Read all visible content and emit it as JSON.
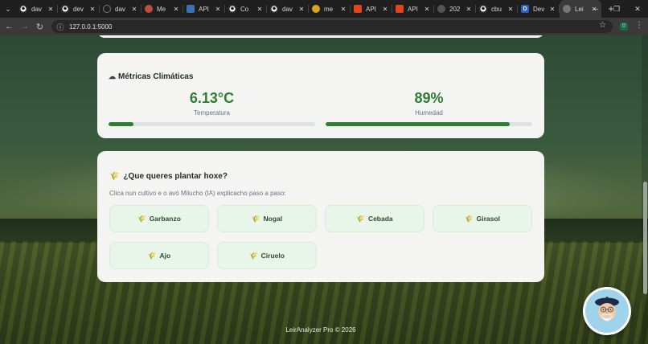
{
  "browser": {
    "tabs": [
      {
        "label": "dav",
        "icon": "github-icon",
        "color": "#2b2b2b"
      },
      {
        "label": "dev",
        "icon": "github-icon",
        "color": "#2b2b2b"
      },
      {
        "label": "dav",
        "icon": "loading-icon",
        "color": "#2b2b2b"
      },
      {
        "label": "Me",
        "icon": "app-icon",
        "color": "#c0503a"
      },
      {
        "label": "API",
        "icon": "doc-icon",
        "color": "#3b6fb6"
      },
      {
        "label": "Co",
        "icon": "github-icon",
        "color": "#2b2b2b"
      },
      {
        "label": "dav",
        "icon": "github-icon",
        "color": "#2b2b2b"
      },
      {
        "label": "me",
        "icon": "emoji-icon",
        "color": "#d9a520"
      },
      {
        "label": "API",
        "icon": "brave-icon",
        "color": "#e2461c"
      },
      {
        "label": "API",
        "icon": "brave-icon",
        "color": "#e2461c"
      },
      {
        "label": "202",
        "icon": "globe-icon",
        "color": "#555555"
      },
      {
        "label": "cbu",
        "icon": "github-icon",
        "color": "#2b2b2b"
      },
      {
        "label": "Dev",
        "icon": "d-icon",
        "color": "#2b5fc4"
      },
      {
        "label": "Lei",
        "icon": "globe-icon",
        "color": "#555555",
        "active": true
      }
    ],
    "url": "127.0.0.1:5000",
    "extension_badge": "0"
  },
  "metrics": {
    "title": "Métricas Climáticas",
    "title_icon": "☁",
    "temperature": {
      "value": "6.13°C",
      "label": "Temperatura",
      "level": 0.12
    },
    "humidity": {
      "value": "89%",
      "label": "Humedad",
      "level": 0.89
    }
  },
  "planting": {
    "icon": "🌾",
    "title": "¿Que queres plantar hoxe?",
    "subtitle": "Clica nun cultivo e o avó Milucho (IA) explicacho paso a paso:",
    "crops": [
      {
        "label": "Garbanzo",
        "icon": "🌾"
      },
      {
        "label": "Nogal",
        "icon": "🌾"
      },
      {
        "label": "Cebada",
        "icon": "🌾"
      },
      {
        "label": "Girasol",
        "icon": "🌾"
      },
      {
        "label": "Ajo",
        "icon": "🌾"
      },
      {
        "label": "Ciruelo",
        "icon": "🌾"
      }
    ]
  },
  "footer": {
    "text": "LeirAnalyzer Pro © 2026"
  },
  "colors": {
    "accent": "#2e7d32",
    "card_bg": "#f4f5f3",
    "crop_bg": "#e8f5e9"
  }
}
